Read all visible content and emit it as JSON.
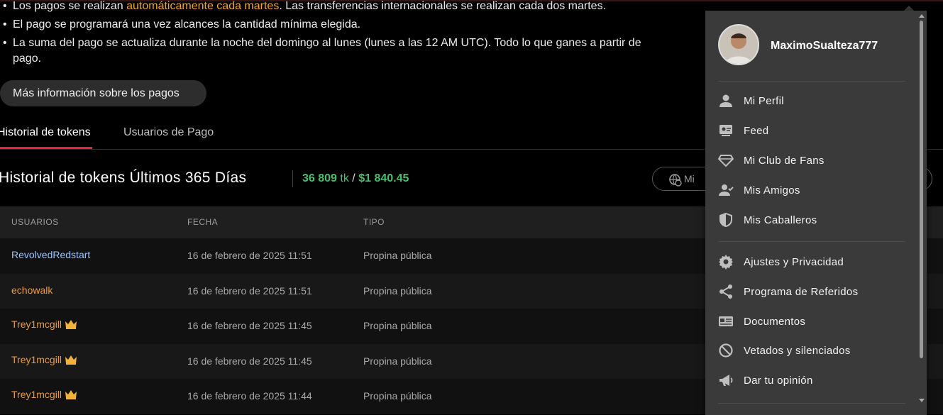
{
  "info": {
    "bullet1_pre": "Los pagos se realizan ",
    "bullet1_highlight": "automáticamente cada martes",
    "bullet1_post": ". Las transferencias internacionales se realizan cada dos martes.",
    "bullet2": "El pago se programará una vez alcances la cantidad mínima elegida.",
    "bullet3": "La suma del pago se actualiza durante la noche del domingo al lunes (lunes a las 12 AM UTC). Todo lo que ganes a partir de",
    "bullet3_cont": "pago.",
    "more_button": "Más información sobre los pagos"
  },
  "tabs": [
    {
      "label": "Historial de tokens"
    },
    {
      "label": "Usuarios de Pago"
    }
  ],
  "history": {
    "title": "Historial de tokens Últimos 365 Días",
    "tokens": "36 809",
    "tokens_unit": "tk",
    "slash": "/",
    "amount": "$1 840.45",
    "filter_label": "Mi"
  },
  "table": {
    "headers": [
      "USUARIOS",
      "FECHA",
      "TIPO"
    ],
    "rows": [
      {
        "user": "RevolvedRedstart",
        "date": "16 de febrero de 2025 11:51",
        "type": "Propina pública"
      },
      {
        "user": "echowalk",
        "date": "16 de febrero de 2025 11:51",
        "type": "Propina pública"
      },
      {
        "user": "Trey1mcgill",
        "date": "16 de febrero de 2025 11:45",
        "type": "Propina pública"
      },
      {
        "user": "Trey1mcgill",
        "date": "16 de febrero de 2025 11:45",
        "type": "Propina pública"
      },
      {
        "user": "Trey1mcgill",
        "date": "16 de febrero de 2025 11:44",
        "type": "Propina pública"
      }
    ]
  },
  "colors": {
    "accent_red": "#e0283a",
    "highlight_orange": "#f5a623",
    "green": "#46c06a",
    "user_orange": "#ef9a3c",
    "user_blue": "#9cc4ff",
    "crown": "#f2b23a"
  },
  "menu": {
    "username": "MaximoSualteza777",
    "items": [
      {
        "label": "Mi Perfil",
        "icon": "person-icon"
      },
      {
        "label": "Feed",
        "icon": "feed-icon"
      },
      {
        "label": "Mi Club de Fans",
        "icon": "diamond-icon"
      },
      {
        "label": "Mis Amigos",
        "icon": "friends-icon"
      },
      {
        "label": "Mis Caballeros",
        "icon": "shield-icon"
      },
      {
        "label": "Ajustes y Privacidad",
        "icon": "gear-icon"
      },
      {
        "label": "Programa de Referidos",
        "icon": "share-icon"
      },
      {
        "label": "Documentos",
        "icon": "id-card-icon"
      },
      {
        "label": "Vetados y silenciados",
        "icon": "ban-icon"
      },
      {
        "label": "Dar tu opinión",
        "icon": "megaphone-icon"
      }
    ]
  }
}
